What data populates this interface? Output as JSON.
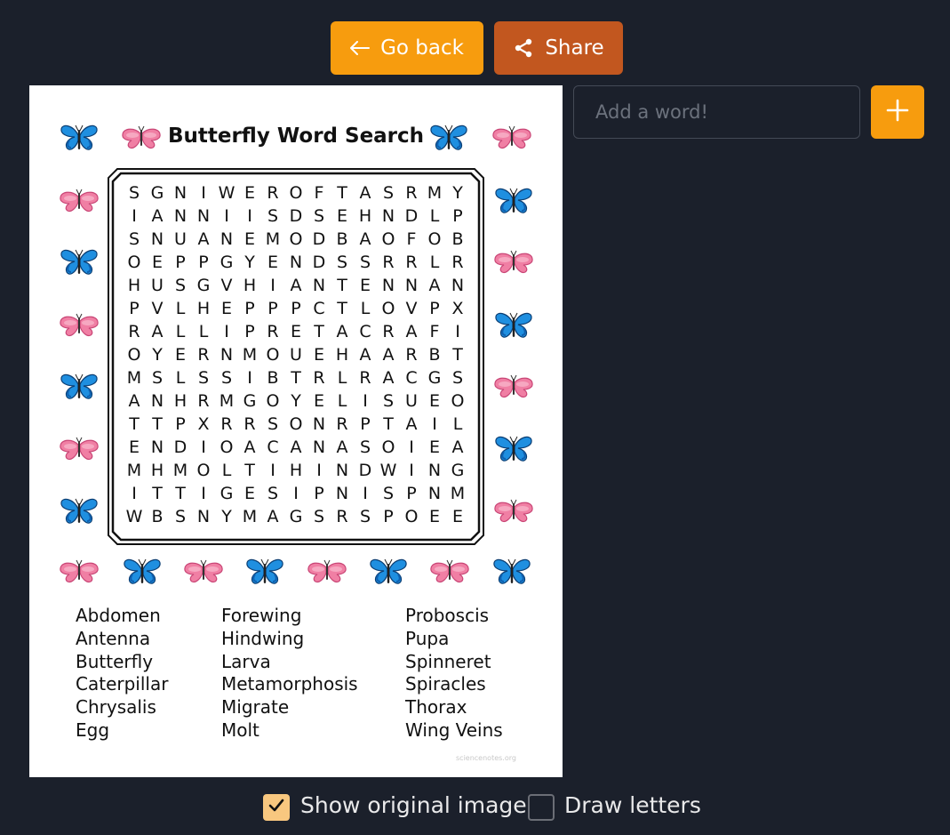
{
  "toolbar": {
    "back_label": "Go back",
    "share_label": "Share",
    "back_icon": "arrow-left-icon",
    "share_icon": "share-icon"
  },
  "add_word": {
    "placeholder": "Add a word!",
    "value": "",
    "button_icon": "plus-icon"
  },
  "puzzle": {
    "title": "Butterfly Word Search",
    "rows": [
      "SGNIWEROFTASRMY",
      "IANNIISDSEHNDLP",
      "SNUANEMODBAOFOB",
      "OEPPGYENDSSRRLR",
      "HUSGVHIANTENNAN",
      "PVLHEPPPCTLOVPX",
      "RALLIPRETACRAFI",
      "OYERNMOUEHAARBT",
      "MSLSSIBTRLRACGS",
      "ANHRMGOYELISUEO",
      "TTPXRRSONRPTAIL",
      "ENDIOACANASOIEA",
      "MHMOLTIHINDWING",
      "ITTIGESIPNISPNM",
      "WBSNYMAGSRSPOEE"
    ],
    "word_columns": [
      [
        "Abdomen",
        "Antenna",
        "Butterfly",
        "Caterpillar",
        "Chrysalis",
        "Egg"
      ],
      [
        "Forewing",
        "Hindwing",
        "Larva",
        "Metamorphosis",
        "Migrate",
        "Molt"
      ],
      [
        "Proboscis",
        "Pupa",
        "Spinneret",
        "Spiracles",
        "Thorax",
        "Wing Veins"
      ]
    ],
    "watermark": "sciencenotes.org"
  },
  "options": {
    "show_original_label": "Show original image",
    "show_original_checked": true,
    "draw_letters_label": "Draw letters",
    "draw_letters_checked": false
  },
  "colors": {
    "background": "#1b202b",
    "accent_orange": "#f79c0e",
    "share_orange": "#c2571f",
    "checkbox_checked": "#f8c77f",
    "butterfly_blue": "#1f8fe0",
    "butterfly_pink": "#f07fa4"
  }
}
